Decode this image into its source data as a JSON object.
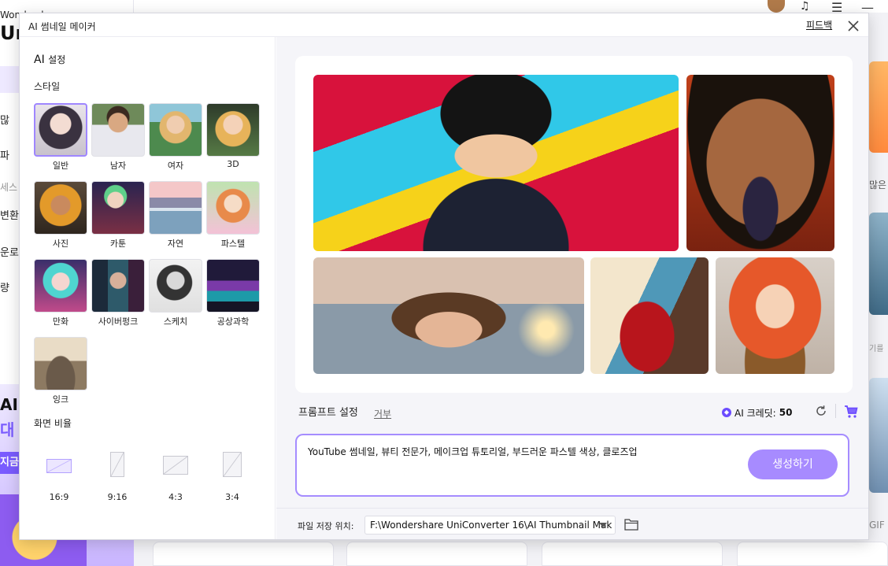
{
  "background": {
    "brand_small": "Wondershare",
    "brand_large": "Uni",
    "sidebar_fragments": [
      "많",
      "파",
      "세스",
      "변환",
      "운로",
      "량"
    ],
    "promo": {
      "ai": "AI",
      "korean": "대",
      "button": "지금"
    },
    "right_fragments": [
      "많은",
      "기를",
      "GIF"
    ]
  },
  "dialog": {
    "title": "AI 썸네일 메이커",
    "feedback": "피드백",
    "close_icon": "close-icon"
  },
  "left_panel": {
    "ai_settings_prefix": "AI",
    "ai_settings_suffix": "설정",
    "style_title": "스타일",
    "styles": [
      {
        "label": "일반",
        "selected": true
      },
      {
        "label": "남자",
        "selected": false
      },
      {
        "label": "여자",
        "selected": false
      },
      {
        "label": "3D",
        "selected": false
      },
      {
        "label": "사진",
        "selected": false
      },
      {
        "label": "카툰",
        "selected": false
      },
      {
        "label": "자연",
        "selected": false
      },
      {
        "label": "파스텔",
        "selected": false
      },
      {
        "label": "만화",
        "selected": false
      },
      {
        "label": "사이버펑크",
        "selected": false
      },
      {
        "label": "스케치",
        "selected": false
      },
      {
        "label": "공상과학",
        "selected": false
      },
      {
        "label": "잉크",
        "selected": false
      }
    ],
    "ratio_title": "화면 비율",
    "ratios": [
      {
        "label": "16:9",
        "selected": true
      },
      {
        "label": "9:16",
        "selected": false
      },
      {
        "label": "4:3",
        "selected": false
      },
      {
        "label": "3:4",
        "selected": false
      }
    ]
  },
  "right_panel": {
    "prompt_title": "프롬프트 설정",
    "reject_link": "거부",
    "credit_label": "AI 크레딧:",
    "credit_value": "50",
    "prompt_text": "YouTube 썸네일, 뷰티 전문가, 메이크업 튜토리얼, 부드러운 파스텔 색상, 클로즈업",
    "generate_button": "생성하기",
    "save_location_label": "파일 저장 위치:",
    "save_path": "F:\\Wondershare UniConverter 16\\AI Thumbnail Mak",
    "accent_color": "#a78bff"
  }
}
